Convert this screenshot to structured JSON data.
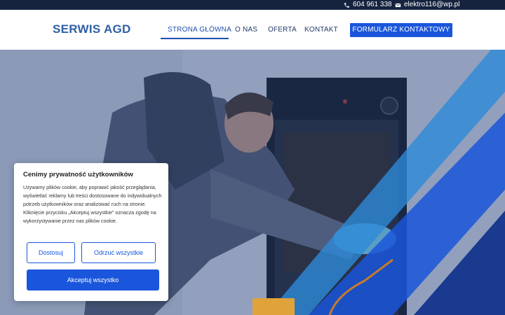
{
  "topbar": {
    "phone": "604 961 338",
    "email": "elektro116@wp.pl",
    "phone_icon": "phone-icon",
    "mail_icon": "envelope-icon"
  },
  "header": {
    "logo": "SERWIS AGD",
    "nav": [
      {
        "label": "STRONA GŁÓWNA",
        "active": true
      },
      {
        "label": "O NAS",
        "active": false
      },
      {
        "label": "OFERTA",
        "active": false
      },
      {
        "label": "KONTAKT",
        "active": false
      }
    ],
    "cta": "FORMULARZ KONTAKTOWY"
  },
  "cookie": {
    "title": "Cenimy prywatność użytkowników",
    "text": "Używamy plików cookie, aby poprawić jakość przeglądania, wyświetlać reklamy lub treści dostosowane do indywidualnych potrzeb użytkowników oraz analizować ruch na stronie. Kliknięcie przycisku „Akceptuj wszystkie” oznacza zgodę na wykorzystywanie przez nas plików cookie.",
    "customize": "Dostosuj",
    "reject": "Odrzuć wszystkie",
    "accept": "Akceptuj wszystko"
  },
  "colors": {
    "topbar_bg": "#15233f",
    "brand_blue": "#1a56db",
    "logo_blue": "#2f5fa6"
  }
}
